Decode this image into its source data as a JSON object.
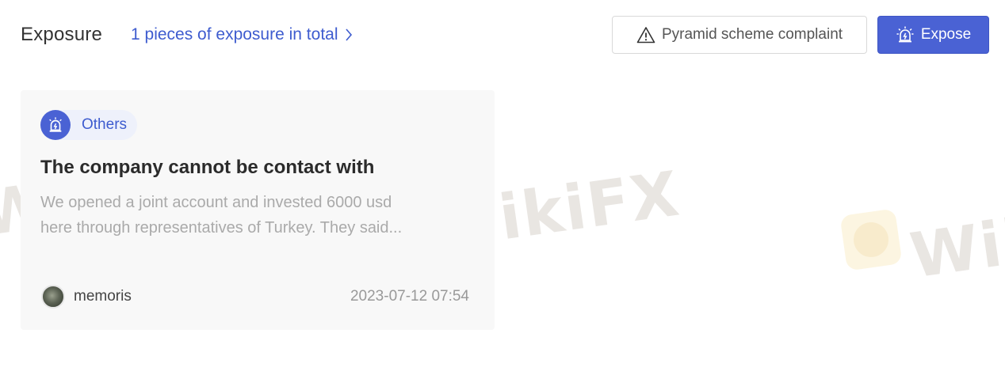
{
  "header": {
    "title": "Exposure",
    "count_link": "1 pieces of exposure in total",
    "complaint_button": "Pyramid scheme complaint",
    "expose_button": "Expose"
  },
  "card": {
    "tag": "Others",
    "title": "The company cannot be contact with",
    "body_line1": "We opened a joint account and invested 6000 usd",
    "body_line2": "here through representatives of Turkey. They said...",
    "author": "memoris",
    "date": "2023-07-12 07:54"
  },
  "watermark": {
    "text": "WikiFX"
  },
  "colors": {
    "accent": "#4a62d4",
    "link": "#3e5ccf"
  }
}
